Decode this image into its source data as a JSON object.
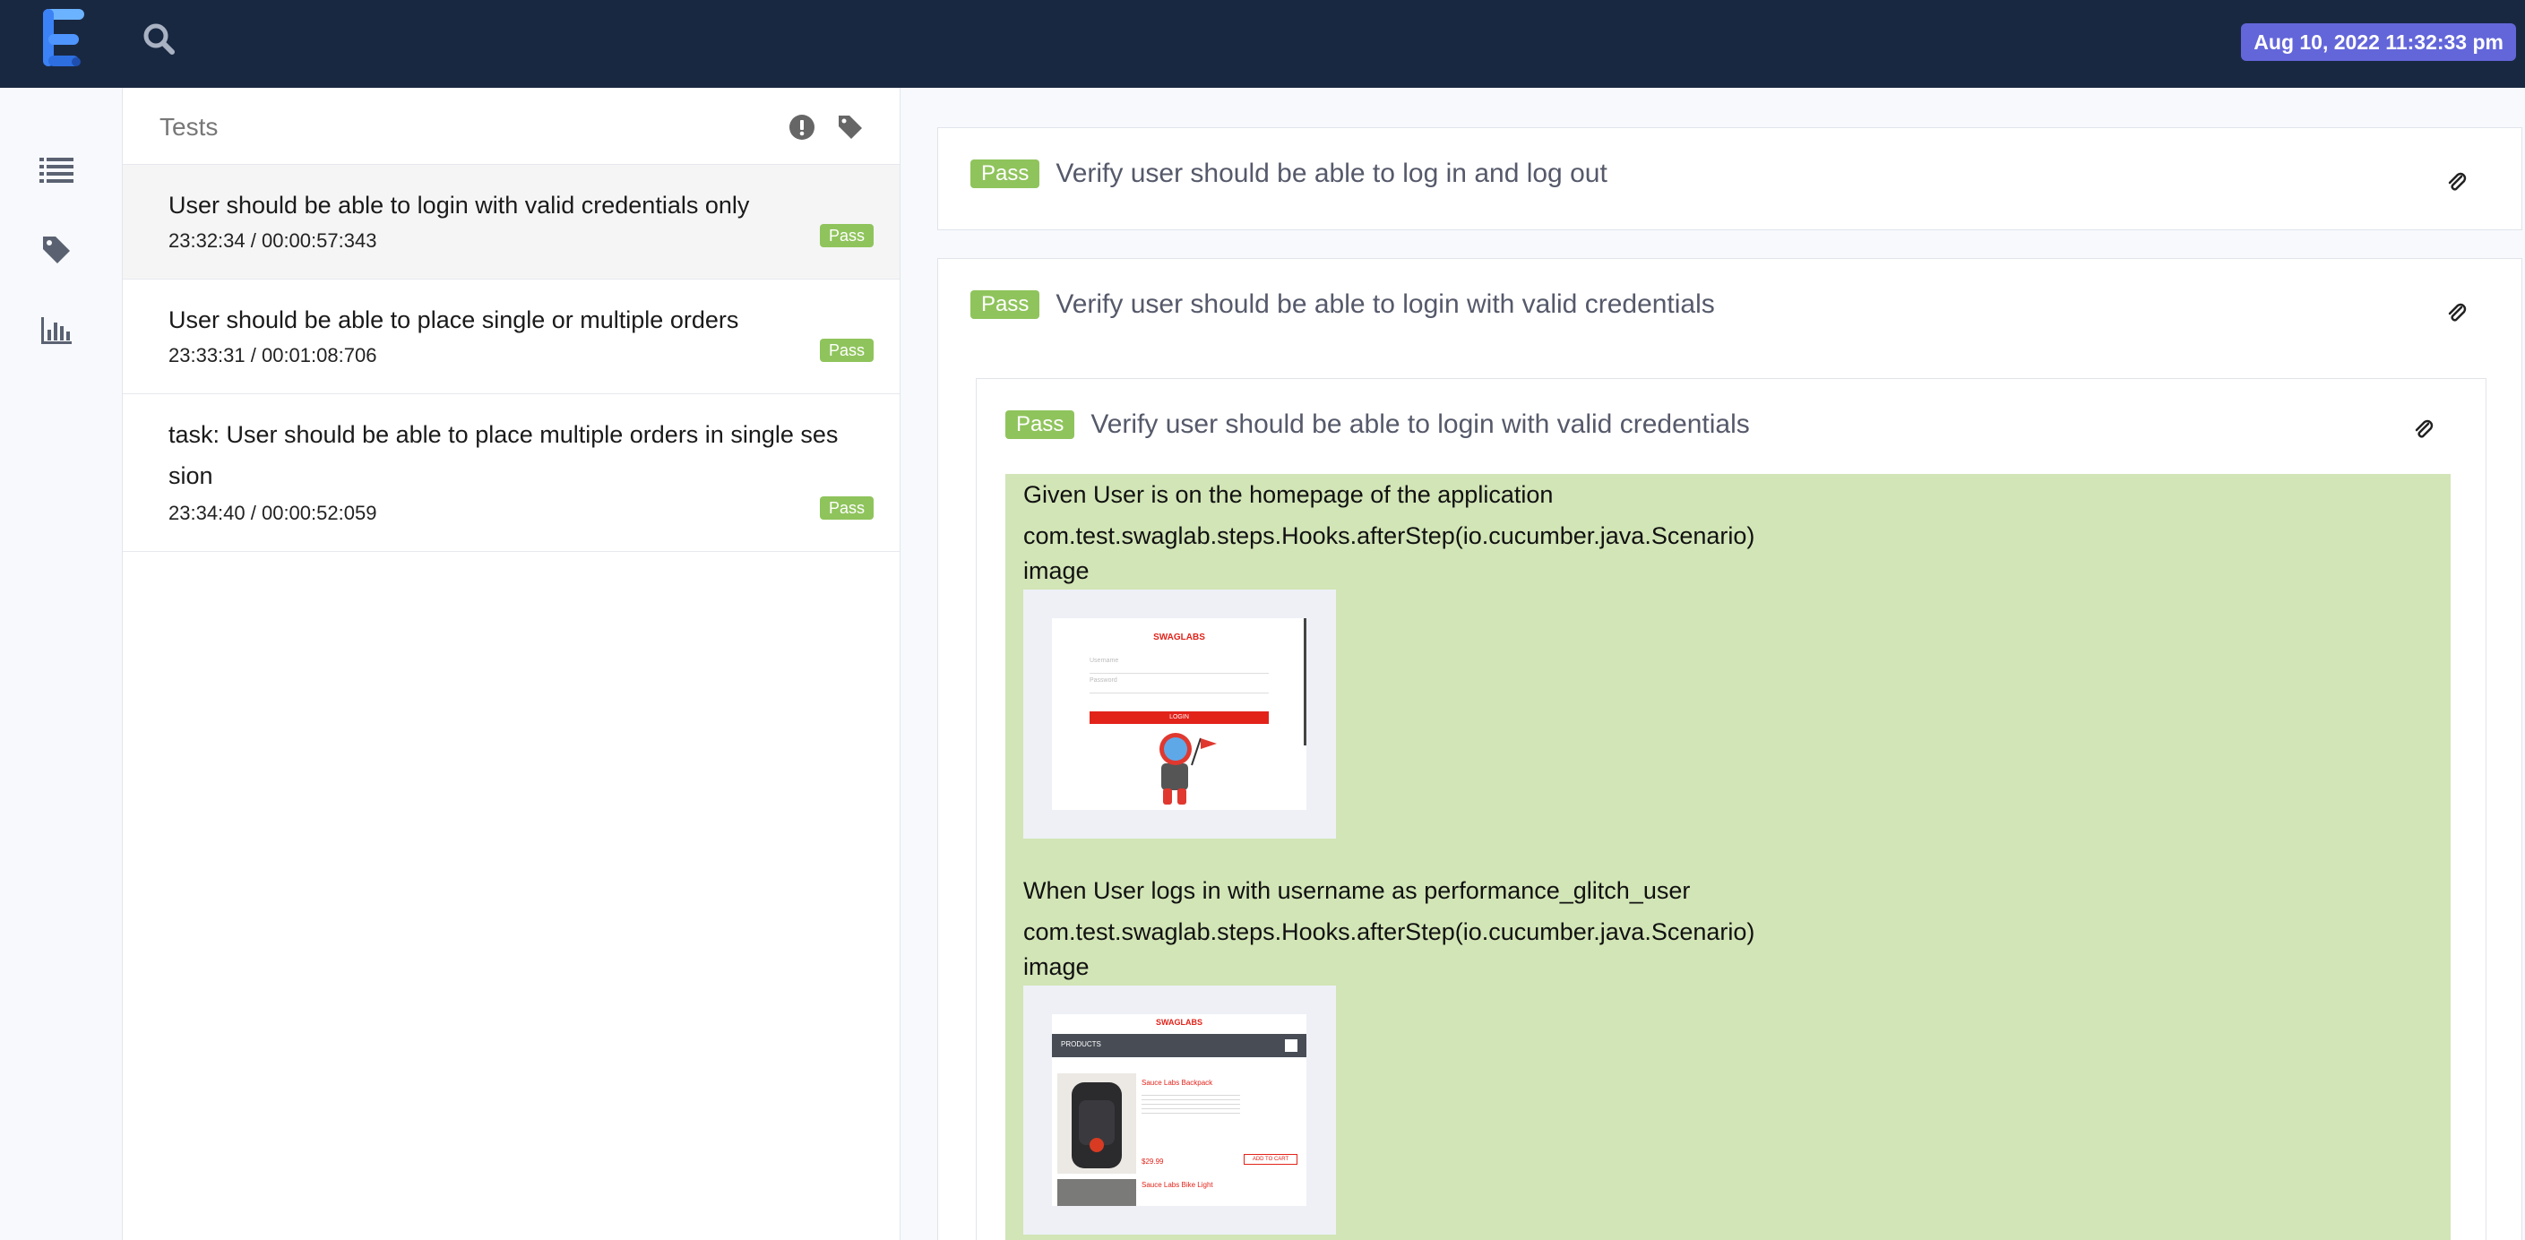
{
  "header": {
    "date": "Aug 10, 2022 11:32:33 pm",
    "logo_icon": "extent-logo",
    "search_icon": "search-icon"
  },
  "nav": {
    "items": [
      {
        "icon": "list-icon"
      },
      {
        "icon": "tag-icon"
      },
      {
        "icon": "bar-chart-icon"
      }
    ]
  },
  "tests": {
    "title": "Tests",
    "items": [
      {
        "name": "User should be able to login with valid credentials only",
        "time": "23:32:34 / 00:00:57:343",
        "status": "Pass"
      },
      {
        "name": "User should be able to place single or multiple orders",
        "time": "23:33:31 / 00:01:08:706",
        "status": "Pass"
      },
      {
        "name": "task: User should be able to place multiple orders in single ses sion",
        "time": "23:34:40 / 00:00:52:059",
        "status": "Pass"
      }
    ]
  },
  "detail": {
    "nodes": [
      {
        "status": "Pass",
        "title": "Verify user should be able to log in and log out"
      },
      {
        "status": "Pass",
        "title": "Verify user should be able to login with valid credentials"
      }
    ],
    "child": {
      "status": "Pass",
      "title": "Verify user should be able to login with valid credentials"
    },
    "steps": [
      {
        "text": "Given User is on the homepage of the application",
        "hook": "com.test.swaglab.steps.Hooks.afterStep(io.cucumber.java.Scenario)",
        "label": "image"
      },
      {
        "text": "When User logs in with username as performance_glitch_user",
        "hook": "com.test.swaglab.steps.Hooks.afterStep(io.cucumber.java.Scenario)",
        "label": "image"
      }
    ],
    "screens": {
      "login": {
        "brand": "SWAGLABS",
        "username_ph": "Username",
        "password_ph": "Password",
        "button": "LOGIN"
      },
      "products": {
        "brand": "SWAGLABS",
        "header": "PRODUCTS",
        "item1": "Sauce Labs Backpack",
        "price": "$29.99",
        "add": "ADD TO CART",
        "item2": "Sauce Labs Bike Light"
      }
    },
    "colors": {
      "pass": "#8fc45c",
      "step_bg": "#d2e5b6",
      "topbar": "#192841",
      "badge": "#6366d9"
    }
  }
}
